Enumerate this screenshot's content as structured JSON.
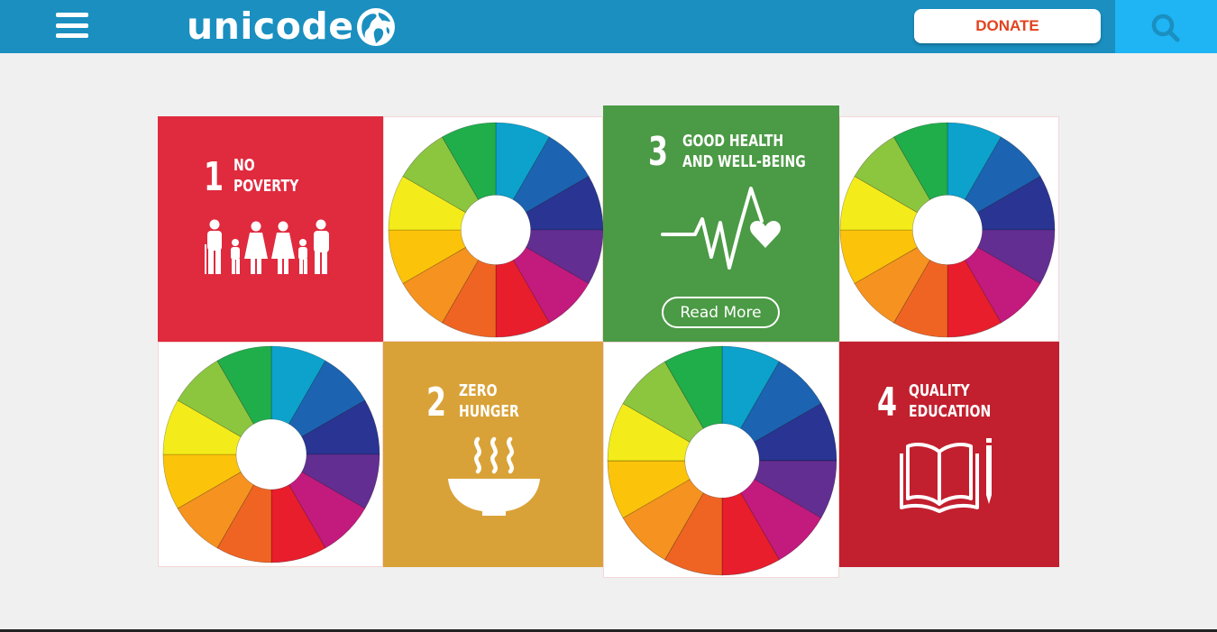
{
  "header": {
    "logo_text": "unicode",
    "donate_label": "DONATE"
  },
  "icons": {
    "menu": "hamburger-menu-icon",
    "search": "search-icon",
    "globe": "globe-icon"
  },
  "colors": {
    "header_bg": "#1a8fc0",
    "search_bg": "#1fb4f4",
    "donate_text": "#e2431f",
    "goal1": "#e02a3e",
    "goal2": "#d9a238",
    "goal3": "#4b9a45",
    "goal4": "#c2202e"
  },
  "goals": [
    {
      "number": "1",
      "title_line1": "NO",
      "title_line2": "POVERTY",
      "icon": "family-icon"
    },
    {
      "number": "2",
      "title_line1": "ZERO",
      "title_line2": "HUNGER",
      "icon": "bowl-icon"
    },
    {
      "number": "3",
      "title_line1": "GOOD HEALTH",
      "title_line2": "AND WELL-BEING",
      "icon": "heartbeat-icon",
      "button_label": "Read More"
    },
    {
      "number": "4",
      "title_line1": "QUALITY",
      "title_line2": "EDUCATION",
      "icon": "book-pencil-icon"
    }
  ],
  "wheel_colors": [
    "#0ca2cc",
    "#1c64b2",
    "#2a3492",
    "#632e92",
    "#c31a7e",
    "#e81e2c",
    "#f06423",
    "#f6921f",
    "#fcc30b",
    "#f3ec1a",
    "#8cc63f",
    "#20ae4b"
  ]
}
